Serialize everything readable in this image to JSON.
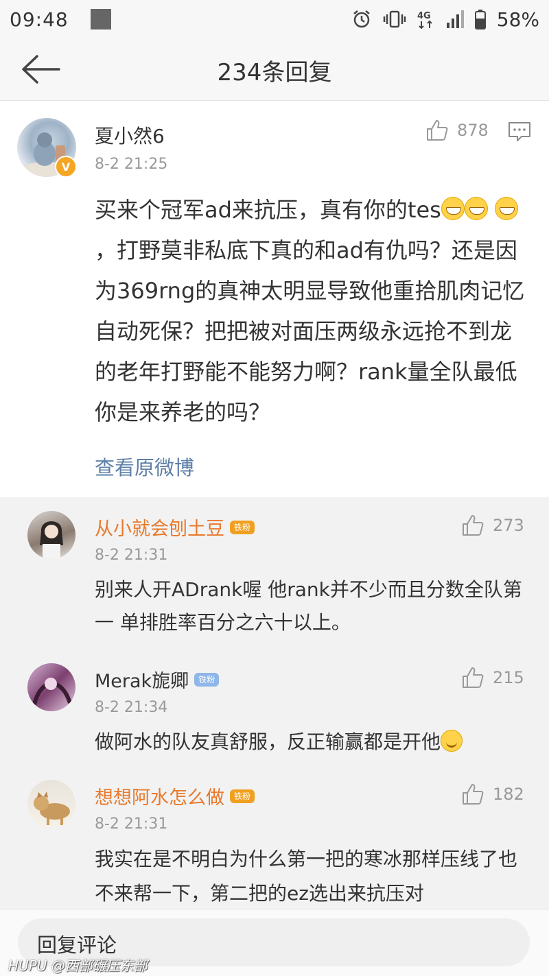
{
  "status_bar": {
    "time": "09:48",
    "battery": "58%",
    "icons": [
      "alarm-icon",
      "vibrate-icon",
      "4g-icon",
      "signal-icon",
      "battery-icon"
    ]
  },
  "header": {
    "title": "234条回复",
    "back_icon": "arrow-left-icon"
  },
  "main_comment": {
    "author": "夏小然6",
    "verified_badge": "V",
    "time": "8-2 21:25",
    "likes": "878",
    "text_1": "买来个冠军ad来抗压，真有你的tes",
    "text_2": "，打野莫非私底下真的和ad有仇吗？还是因为369rng的真神太明显导致他重拾肌肉记忆自动死保？把把被对面压两级永远抢不到龙的老年打野能不能努力啊？rank量全队最低你是来养老的吗？",
    "view_original": "查看原微博"
  },
  "replies": [
    {
      "author": "从小就会刨土豆",
      "badge": "铁粉",
      "time": "8-2 21:31",
      "likes": "273",
      "text": "别来人开ADrank喔 他rank并不少而且分数全队第一 单排胜率百分之六十以上。",
      "name_color": "#e8792b"
    },
    {
      "author": "Merak旎卿",
      "badge": "铁粉",
      "time": "8-2 21:34",
      "likes": "215",
      "text": "做阿水的队友真舒服，反正输赢都是开他",
      "name_color": "#333333"
    },
    {
      "author": "想想阿水怎么做",
      "badge": "铁粉",
      "time": "8-2 21:31",
      "likes": "182",
      "text": "我实在是不明白为什么第一把的寒冰那样压线了也不来帮一下，第二把的ez选出来抗压对",
      "name_color": "#e8792b"
    }
  ],
  "bottom_bar": {
    "placeholder": "回复评论"
  },
  "watermark": "HUPU @西部碾压东部",
  "colors": {
    "link": "#5d7fa8",
    "orange_name": "#e8792b",
    "reply_bg": "#f2f2f2"
  }
}
